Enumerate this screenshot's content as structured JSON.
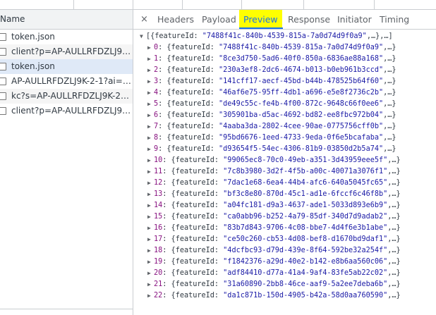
{
  "list": {
    "header": "Name",
    "items": [
      {
        "name": "token.json",
        "state": "normal"
      },
      {
        "name": "client?p=AP-AULLRFDZLJ9K-2...",
        "state": "alt"
      },
      {
        "name": "token.json",
        "state": "selected"
      },
      {
        "name": "AP-AULLRFDZLJ9K-2-1?ai=d5...",
        "state": "normal"
      },
      {
        "name": "kc?s=AP-AULLRFDZLJ9K-2-1-...",
        "state": "alt"
      },
      {
        "name": "client?p=AP-AULLRFDZLJ9K-2...",
        "state": "normal"
      }
    ]
  },
  "tabs": {
    "close": "×",
    "items": [
      "Headers",
      "Payload",
      "Preview",
      "Response",
      "Initiator",
      "Timing"
    ],
    "active": "Preview",
    "highlight_color": "#ffff00",
    "accent_color": "#1a73e8"
  },
  "preview": {
    "root": {
      "open": "[{featureId: ",
      "value": "\"7488f41c-840b-4539-815a-7a0d74d9f0a9\"",
      "tail": ",…},…]"
    },
    "key": "featureId",
    "entries": [
      {
        "index": "0",
        "value": "\"7488f41c-840b-4539-815a-7a0d74d9f0a9\""
      },
      {
        "index": "1",
        "value": "\"8ce3d750-5ad6-40f0-850a-6836ae88a168\""
      },
      {
        "index": "2",
        "value": "\"230a3ef8-2dc6-4674-b013-b0eb961b3ccd\""
      },
      {
        "index": "3",
        "value": "\"141cff17-aecf-45bd-b44b-478525b64f60\""
      },
      {
        "index": "4",
        "value": "\"46af6e75-95ff-4db1-a696-e5e8f2736c2b\""
      },
      {
        "index": "5",
        "value": "\"de49c55c-fe4b-4f00-872c-9648c66f0ee6\""
      },
      {
        "index": "6",
        "value": "\"305901ba-d5ac-4692-bd82-ee8fbc972b04\""
      },
      {
        "index": "7",
        "value": "\"4aaba3da-2802-4cee-90ae-0775756cff0b\""
      },
      {
        "index": "8",
        "value": "\"95bd6676-1eed-4733-9eda-0f6e5bcafaba\""
      },
      {
        "index": "9",
        "value": "\"d93654f5-54ec-4306-81b9-03850d2b5a74\""
      },
      {
        "index": "10",
        "value": "\"99065ec8-70c0-49eb-a351-3d43959eee5f\""
      },
      {
        "index": "11",
        "value": "\"7c8b3980-3d2f-4f5b-a00c-40071a3076f1\""
      },
      {
        "index": "12",
        "value": "\"7dac1e68-6ea4-44b4-afc6-640a5045fc65\""
      },
      {
        "index": "13",
        "value": "\"bf3c8e80-870d-45c1-ad1e-6fccf6c46f8b\""
      },
      {
        "index": "14",
        "value": "\"a04fc181-d9a3-4637-ade1-5033d893e6b9\""
      },
      {
        "index": "15",
        "value": "\"ca0abb96-b252-4a79-85df-340d7d9adab2\""
      },
      {
        "index": "16",
        "value": "\"83b7d843-9706-4c08-bbe7-4d4f6e3b1abe\""
      },
      {
        "index": "17",
        "value": "\"ce50c260-cb53-4d08-bef8-d1670bd9daf1\""
      },
      {
        "index": "18",
        "value": "\"4dcfbc93-d79d-439e-8f64-592be32a254f\""
      },
      {
        "index": "19",
        "value": "\"f1842376-a29d-40e2-b142-e8b6aa560c06\""
      },
      {
        "index": "20",
        "value": "\"adf84410-d77a-41a4-9af4-83fe5ab22c02\""
      },
      {
        "index": "21",
        "value": "\"31a60890-2bb8-46ce-aaf9-5a2ee7deba6b\""
      },
      {
        "index": "22",
        "value": "\"da1c871b-150d-4905-b42a-58d0aa760590\""
      }
    ],
    "entry_tail": ",…}",
    "expand_open_icon": "triangle-down-icon",
    "expand_closed_icon": "triangle-right-icon"
  }
}
